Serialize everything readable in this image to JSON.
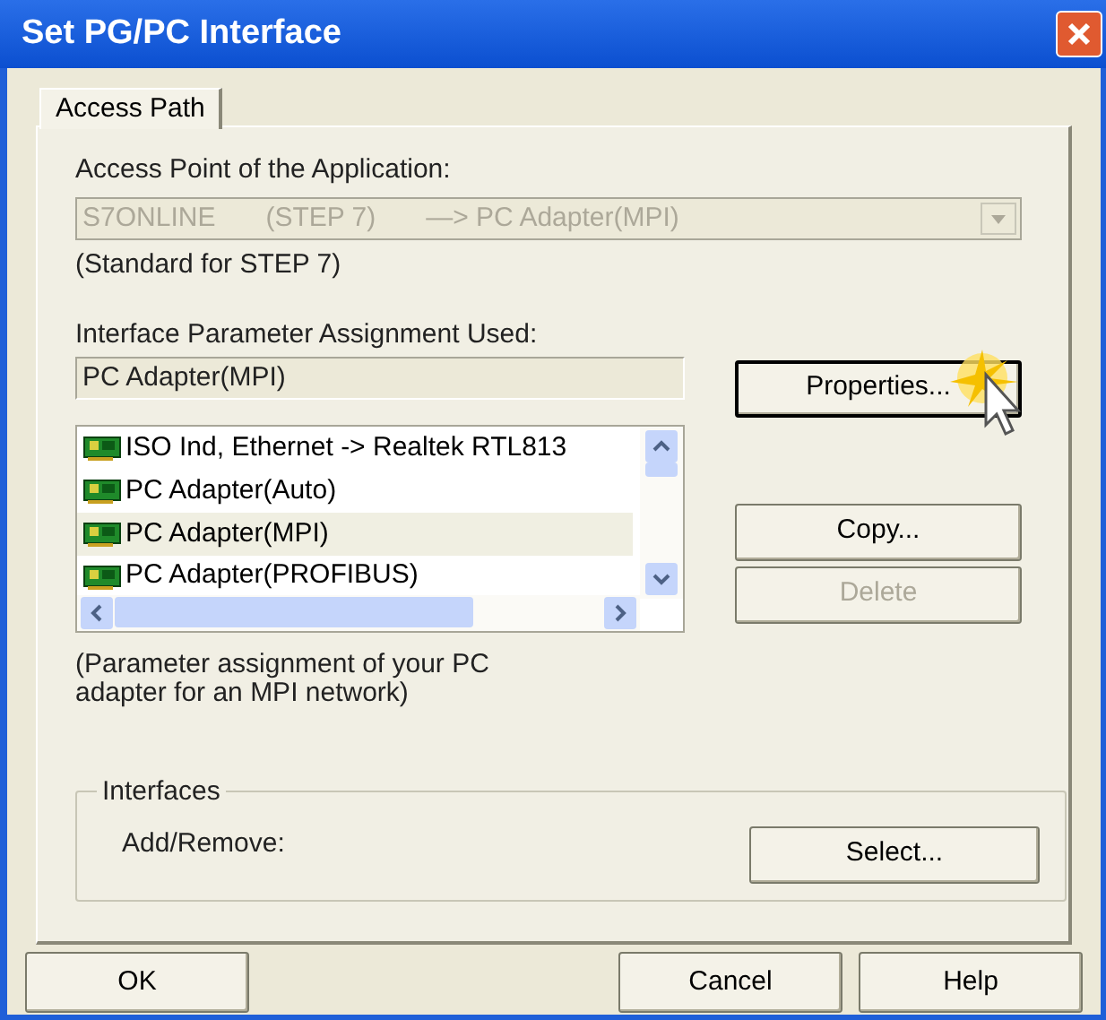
{
  "window": {
    "title": "Set PG/PC Interface"
  },
  "tabs": [
    {
      "label": "Access Path",
      "selected": true
    }
  ],
  "access_point": {
    "label": "Access Point of the Application:",
    "value": [
      "S7ONLINE",
      "(STEP 7)",
      "—> PC Adapter(MPI)"
    ],
    "disabled": true,
    "note": "(Standard for STEP 7)"
  },
  "parameter_assignment": {
    "label": "Interface Parameter Assignment Used:",
    "value": "PC Adapter(MPI)",
    "properties_button": "Properties...",
    "items": [
      {
        "label": "ISO Ind, Ethernet -> Realtek RTL813",
        "selected": false
      },
      {
        "label": "PC Adapter(Auto)",
        "selected": false
      },
      {
        "label": "PC Adapter(MPI)",
        "selected": true
      },
      {
        "label": "PC Adapter(PROFIBUS)",
        "selected": false
      }
    ],
    "description": "(Parameter assignment of your PC adapter for an MPI network)"
  },
  "side_buttons": [
    {
      "label": "Copy...",
      "disabled": false
    },
    {
      "label": "Delete",
      "disabled": true
    }
  ],
  "interfaces": {
    "title": "Interfaces",
    "label": "Add/Remove:",
    "button": "Select..."
  },
  "buttons": [
    "OK",
    "Cancel",
    "Help"
  ]
}
